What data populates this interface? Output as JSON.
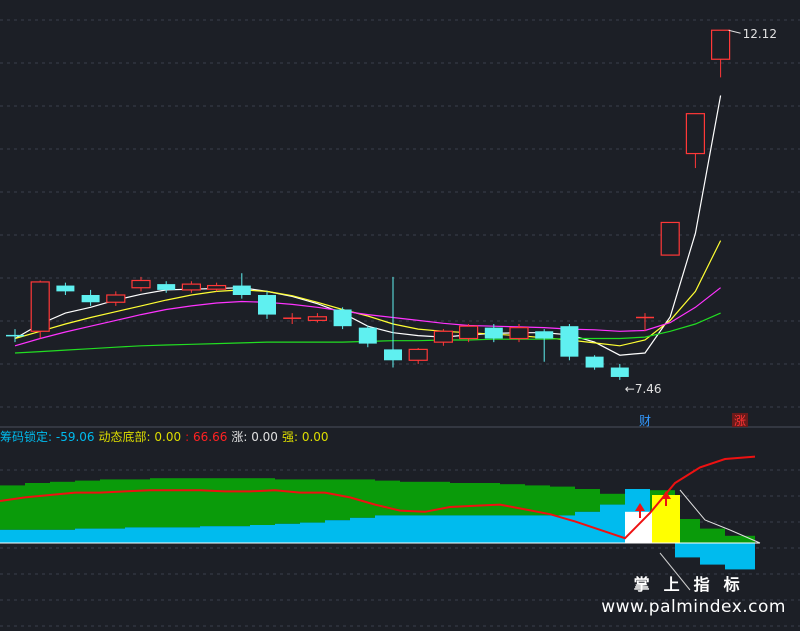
{
  "chart_data": [
    {
      "type": "candlestick",
      "candles": [
        {
          "o": 8.0,
          "c": 7.98,
          "h": 8.08,
          "l": 7.9
        },
        {
          "o": 8.05,
          "c": 8.73,
          "h": 8.75,
          "l": 7.95
        },
        {
          "o": 8.68,
          "c": 8.6,
          "h": 8.72,
          "l": 8.55
        },
        {
          "o": 8.55,
          "c": 8.45,
          "h": 8.62,
          "l": 8.4
        },
        {
          "o": 8.45,
          "c": 8.55,
          "h": 8.6,
          "l": 8.4
        },
        {
          "o": 8.65,
          "c": 8.75,
          "h": 8.8,
          "l": 8.6
        },
        {
          "o": 8.7,
          "c": 8.62,
          "h": 8.74,
          "l": 8.58
        },
        {
          "o": 8.62,
          "c": 8.7,
          "h": 8.74,
          "l": 8.58
        },
        {
          "o": 8.63,
          "c": 8.68,
          "h": 8.72,
          "l": 8.6
        },
        {
          "o": 8.68,
          "c": 8.55,
          "h": 8.85,
          "l": 8.5
        },
        {
          "o": 8.55,
          "c": 8.28,
          "h": 8.6,
          "l": 8.22
        },
        {
          "o": 8.24,
          "c": 8.24,
          "h": 8.3,
          "l": 8.15
        },
        {
          "o": 8.2,
          "c": 8.25,
          "h": 8.3,
          "l": 8.17
        },
        {
          "o": 8.35,
          "c": 8.12,
          "h": 8.38,
          "l": 8.08
        },
        {
          "o": 8.1,
          "c": 7.88,
          "h": 8.13,
          "l": 7.83
        },
        {
          "o": 7.8,
          "c": 7.65,
          "h": 8.8,
          "l": 7.55
        },
        {
          "o": 7.65,
          "c": 7.8,
          "h": 7.82,
          "l": 7.6
        },
        {
          "o": 7.9,
          "c": 8.05,
          "h": 8.08,
          "l": 7.85
        },
        {
          "o": 7.95,
          "c": 8.12,
          "h": 8.15,
          "l": 7.9
        },
        {
          "o": 8.1,
          "c": 7.95,
          "h": 8.15,
          "l": 7.9
        },
        {
          "o": 7.95,
          "c": 8.1,
          "h": 8.15,
          "l": 7.9
        },
        {
          "o": 8.05,
          "c": 7.95,
          "h": 8.08,
          "l": 7.63
        },
        {
          "o": 8.12,
          "c": 7.7,
          "h": 8.15,
          "l": 7.65
        },
        {
          "o": 7.7,
          "c": 7.55,
          "h": 7.72,
          "l": 7.52
        },
        {
          "o": 7.55,
          "c": 7.42,
          "h": 7.6,
          "l": 7.38
        },
        {
          "o": 8.25,
          "c": 8.25,
          "h": 8.3,
          "l": 8.05
        },
        {
          "o": 9.1,
          "c": 9.55,
          "h": 9.55,
          "l": 9.1
        },
        {
          "o": 10.5,
          "c": 11.05,
          "h": 11.05,
          "l": 10.3
        },
        {
          "o": 11.8,
          "c": 12.2,
          "h": 12.2,
          "l": 11.55
        }
      ],
      "moving_averages": [
        {
          "color": "#ffffff",
          "values": [
            7.95,
            8.15,
            8.3,
            8.38,
            8.48,
            8.56,
            8.62,
            8.63,
            8.64,
            8.65,
            8.6,
            8.53,
            8.43,
            8.3,
            8.12,
            8.03,
            7.99,
            7.97,
            8.0,
            8.02,
            8.03,
            8.03,
            8.0,
            7.9,
            7.72,
            7.75,
            8.25,
            9.4,
            11.3
          ]
        },
        {
          "color": "#ffff33",
          "values": [
            7.95,
            8.05,
            8.15,
            8.24,
            8.32,
            8.4,
            8.48,
            8.55,
            8.6,
            8.62,
            8.6,
            8.54,
            8.45,
            8.35,
            8.26,
            8.15,
            8.08,
            8.05,
            8.03,
            8.01,
            7.99,
            7.96,
            7.93,
            7.89,
            7.85,
            7.93,
            8.2,
            8.6,
            9.3
          ]
        },
        {
          "color": "#ff33ff",
          "values": [
            7.85,
            7.95,
            8.04,
            8.12,
            8.2,
            8.28,
            8.35,
            8.4,
            8.44,
            8.46,
            8.45,
            8.42,
            8.38,
            8.33,
            8.28,
            8.24,
            8.2,
            8.16,
            8.13,
            8.12,
            8.11,
            8.1,
            8.08,
            8.07,
            8.05,
            8.06,
            8.17,
            8.38,
            8.65
          ]
        },
        {
          "color": "#22dd22",
          "values": [
            7.75,
            7.77,
            7.79,
            7.81,
            7.83,
            7.85,
            7.86,
            7.87,
            7.88,
            7.89,
            7.9,
            7.9,
            7.9,
            7.9,
            7.91,
            7.92,
            7.92,
            7.93,
            7.93,
            7.94,
            7.94,
            7.94,
            7.95,
            7.95,
            7.95,
            7.97,
            8.05,
            8.15,
            8.3
          ]
        }
      ],
      "annotations": {
        "high": "12.12",
        "low": "7.46"
      },
      "markers": [
        {
          "index": 25,
          "text": "财",
          "color": "#3399ff"
        },
        {
          "index": 29,
          "text": "涨",
          "color": "#ff3333"
        }
      ],
      "ylim": [
        7.13,
        12.41
      ],
      "grid": true
    },
    {
      "type": "area",
      "legend": [
        {
          "label": "筹码锁定:",
          "value": "-59.06",
          "color": "#00bbee"
        },
        {
          "label": "动态底部:",
          "value": "0.00",
          "color": "#dddd00"
        },
        {
          "label": ":",
          "value": "66.66",
          "color": "#ff2222"
        },
        {
          "label": "涨:",
          "value": "0.00",
          "color": "#e0e0e0"
        },
        {
          "label": "强:",
          "value": "0.00",
          "color": "#dddd00"
        }
      ],
      "x": [
        0,
        25,
        50,
        75,
        100,
        125,
        150,
        175,
        200,
        225,
        250,
        275,
        300,
        325,
        350,
        375,
        400,
        425,
        450,
        475,
        500,
        525,
        550,
        575,
        600,
        625,
        650,
        675,
        700,
        725,
        755
      ],
      "green_top": [
        48,
        50,
        51,
        52,
        53,
        53,
        54,
        54,
        54,
        54,
        54,
        53,
        53,
        53,
        53,
        52,
        51,
        51,
        50,
        50,
        49,
        48,
        47,
        45,
        41,
        41,
        44,
        20,
        12,
        6,
        3
      ],
      "cyan_top": [
        11,
        11,
        11,
        12,
        12,
        13,
        13,
        13,
        14,
        14,
        15,
        16,
        17,
        19,
        21,
        23,
        23,
        23,
        23,
        23,
        23,
        23,
        23,
        26,
        32,
        45,
        0,
        -12,
        -18,
        -22,
        -70
      ],
      "red_line": [
        35,
        38,
        40,
        42,
        42,
        43,
        44,
        44,
        44,
        43,
        43,
        44,
        42,
        42,
        38,
        32,
        27,
        26,
        30,
        31,
        32,
        28,
        24,
        18,
        11,
        4,
        25,
        50,
        63,
        70,
        72
      ],
      "white_block": {
        "from": 625,
        "to": 652,
        "value": 26
      },
      "yellow_block": {
        "from": 652,
        "to": 680,
        "value": 40
      },
      "arrows": [
        {
          "x": 640,
          "value": 30
        },
        {
          "x": 666,
          "value": 40
        }
      ],
      "grid": true
    }
  ],
  "watermark": {
    "cn": "掌上指标",
    "url": "www.palmindex.com"
  }
}
